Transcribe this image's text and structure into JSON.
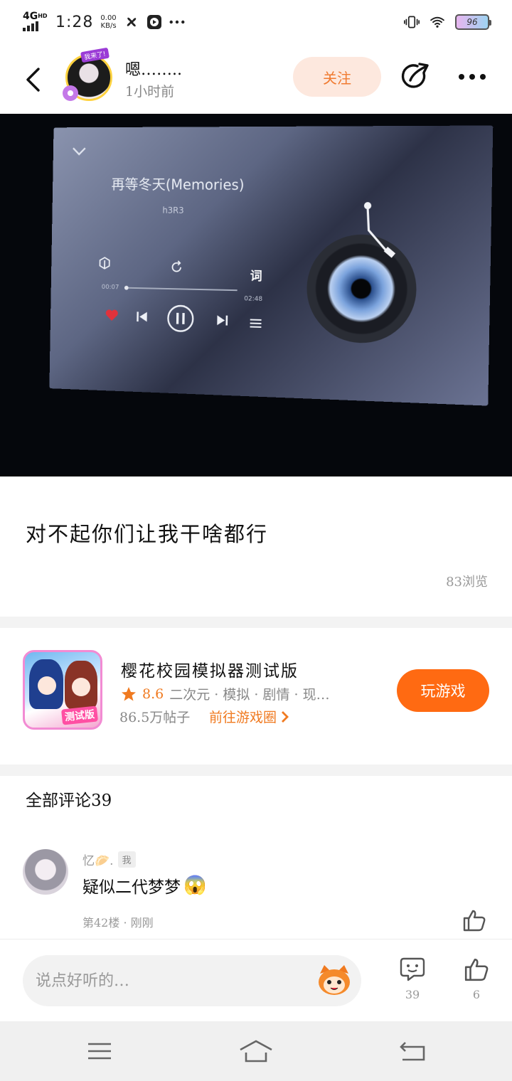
{
  "status_bar": {
    "network": "4G",
    "network_sup": "HD",
    "time": "1:28",
    "speed_value": "0.00",
    "speed_unit": "KB/s",
    "battery": "96"
  },
  "header": {
    "username": "嗯……..",
    "time_ago": "1小时前",
    "avatar_badge": "我来了!",
    "follow_label": "关注"
  },
  "post_image": {
    "song_title": "再等冬天(Memories)",
    "artist": "h3R3",
    "lyric_label": "词",
    "time_start": "00:07",
    "time_end": "02:48"
  },
  "post": {
    "caption": "对不起你们让我干啥都行",
    "views": "83浏览"
  },
  "game": {
    "name": "樱花校园模拟器测试版",
    "icon_tag": "测试版",
    "rating": "8.6",
    "tags": "二次元 · 模拟 · 剧情 · 现…",
    "posts": "86.5万帖子",
    "link": "前往游戏圈",
    "play_label": "玩游戏"
  },
  "comments": {
    "title": "全部评论39",
    "items": [
      {
        "author": "忆🥟.",
        "badge": "我",
        "text": "疑似二代梦梦",
        "emoji": "😱",
        "meta": "第42楼 · 刚刚"
      }
    ]
  },
  "bottom_bar": {
    "placeholder": "说点好听的…",
    "comment_count": "39",
    "like_count": "6"
  },
  "colors": {
    "accent": "#ff6a12",
    "follow_bg": "#fde8de",
    "follow_text": "#f07a30"
  }
}
